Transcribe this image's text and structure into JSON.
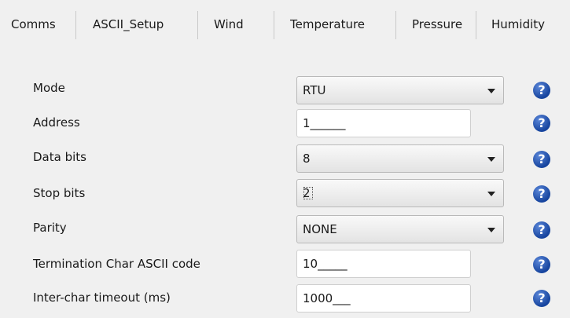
{
  "tabs": [
    "Comms",
    "ASCII_Setup",
    "Wind",
    "Temperature",
    "Pressure",
    "Humidity"
  ],
  "help_glyph": "?",
  "rows": [
    {
      "label": "Mode",
      "type": "select",
      "value": "RTU"
    },
    {
      "label": "Address",
      "type": "text",
      "value": "1______"
    },
    {
      "label": "Data bits",
      "type": "select",
      "value": "8"
    },
    {
      "label": "Stop bits",
      "type": "select",
      "value": "2",
      "focused": true
    },
    {
      "label": "Parity",
      "type": "select",
      "value": "NONE"
    },
    {
      "label": "Termination Char ASCII code",
      "type": "text",
      "value": "10_____"
    },
    {
      "label": "Inter-char timeout (ms)",
      "type": "text",
      "value": "1000___"
    }
  ],
  "colors": {
    "help_icon": "#1a4fb0",
    "background": "#f0f0f0"
  }
}
